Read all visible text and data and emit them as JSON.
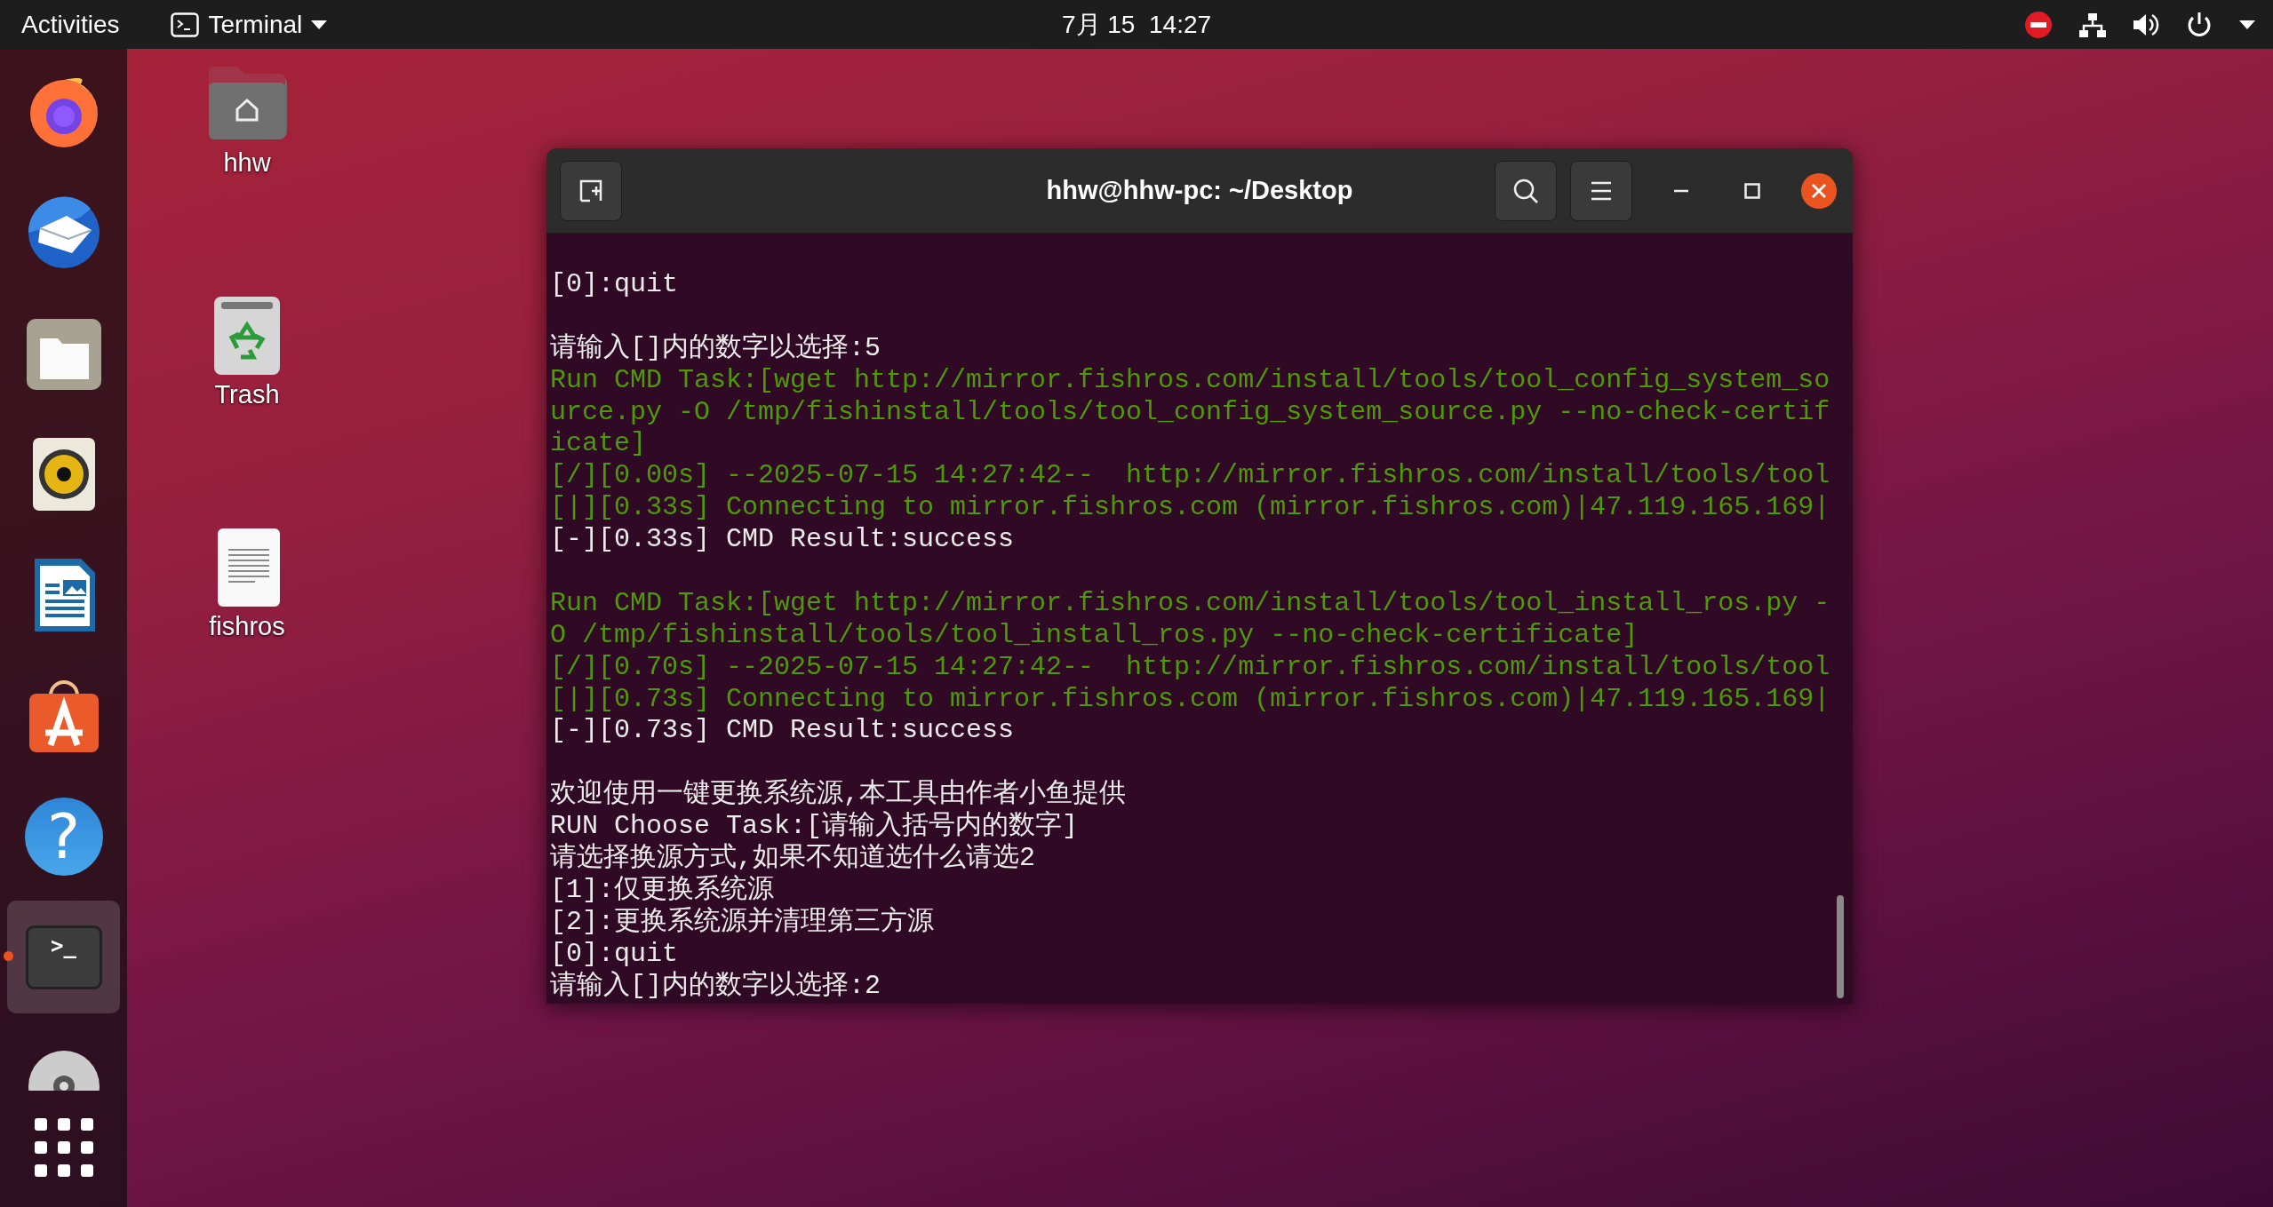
{
  "top_bar": {
    "activities": "Activities",
    "app_menu": "Terminal",
    "clock": "7月 15  14:27"
  },
  "dock": [
    {
      "kind": "browser",
      "selected": false,
      "running": false
    },
    {
      "kind": "mail",
      "selected": false,
      "running": false
    },
    {
      "kind": "files",
      "selected": false,
      "running": false
    },
    {
      "kind": "music",
      "selected": false,
      "running": false
    },
    {
      "kind": "writer",
      "selected": false,
      "running": false
    },
    {
      "kind": "store",
      "selected": false,
      "running": false
    },
    {
      "kind": "help",
      "glyph": "?",
      "selected": false,
      "running": false
    },
    {
      "kind": "terminal",
      "glyph": ">_",
      "selected": true,
      "running": true
    },
    {
      "kind": "disc",
      "selected": false,
      "running": false
    }
  ],
  "desktop_icons": [
    {
      "kind": "home",
      "label": "hhw"
    },
    {
      "kind": "trash",
      "label": "Trash"
    },
    {
      "kind": "document",
      "label": "fishros"
    }
  ],
  "window": {
    "title": "hhw@hhw-pc: ~/Desktop",
    "lines": [
      {
        "kind": "plain",
        "text": "[0]:quit"
      },
      {
        "kind": "blank"
      },
      {
        "kind": "plain",
        "text": "请输入[]内的数字以选择:5"
      },
      {
        "kind": "output",
        "text": "Run CMD Task:[wget http://mirror.fishros.com/install/tools/tool_config_system_so"
      },
      {
        "kind": "output",
        "text": "urce.py -O /tmp/fishinstall/tools/tool_config_system_source.py --no-check-certif"
      },
      {
        "kind": "output",
        "text": "icate]"
      },
      {
        "kind": "output",
        "text": "[/][0.00s] --2025-07-15 14:27:42--  http://mirror.fishros.com/install/tools/tool"
      },
      {
        "kind": "output",
        "text": "[|][0.33s] Connecting to mirror.fishros.com (mirror.fishros.com)|47.119.165.169|"
      },
      {
        "kind": "plain",
        "text": "[-][0.33s] CMD Result:success"
      },
      {
        "kind": "blank"
      },
      {
        "kind": "output",
        "text": "Run CMD Task:[wget http://mirror.fishros.com/install/tools/tool_install_ros.py -"
      },
      {
        "kind": "output",
        "text": "O /tmp/fishinstall/tools/tool_install_ros.py --no-check-certificate]"
      },
      {
        "kind": "output",
        "text": "[/][0.70s] --2025-07-15 14:27:42--  http://mirror.fishros.com/install/tools/tool"
      },
      {
        "kind": "output",
        "text": "[|][0.73s] Connecting to mirror.fishros.com (mirror.fishros.com)|47.119.165.169|"
      },
      {
        "kind": "plain",
        "text": "[-][0.73s] CMD Result:success"
      },
      {
        "kind": "blank"
      },
      {
        "kind": "plain",
        "text": "欢迎使用一键更换系统源,本工具由作者小鱼提供"
      },
      {
        "kind": "plain",
        "text": "RUN Choose Task:[请输入括号内的数字]"
      },
      {
        "kind": "plain",
        "text": "请选择换源方式,如果不知道选什么请选2"
      },
      {
        "kind": "plain",
        "text": "[1]:仅更换系统源"
      },
      {
        "kind": "plain",
        "text": "[2]:更换系统源并清理第三方源"
      },
      {
        "kind": "plain",
        "text": "[0]:quit"
      },
      {
        "kind": "plain",
        "text": "请输入[]内的数字以选择:2"
      }
    ]
  }
}
